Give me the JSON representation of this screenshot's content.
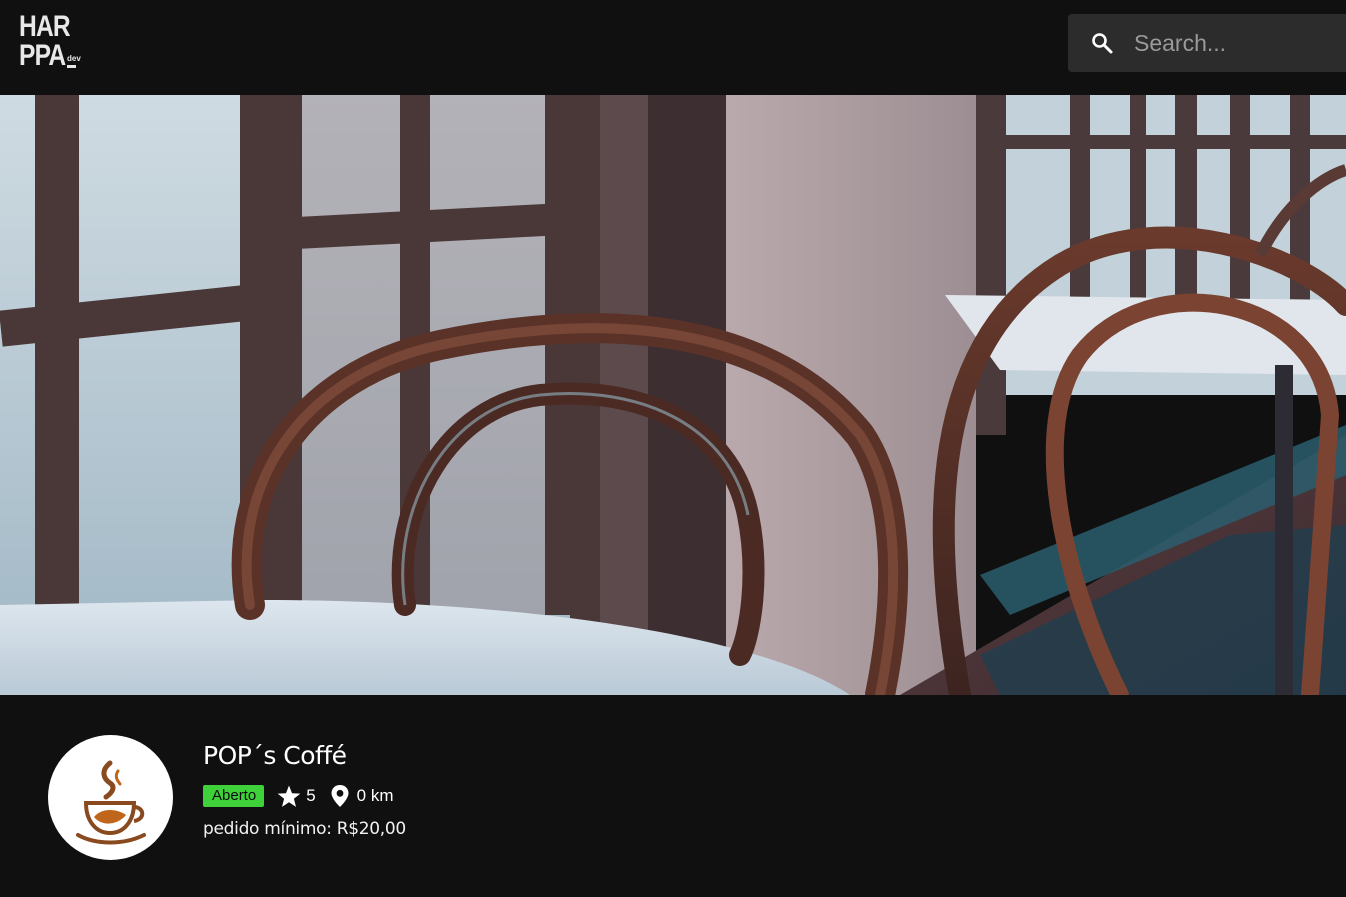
{
  "header": {
    "logo": {
      "line1": "HAR",
      "line2": "PPA",
      "suffix": "dev"
    },
    "search": {
      "placeholder": "Search...",
      "value": "",
      "icon": "search-icon"
    }
  },
  "banner": {
    "image": "cafe-chairs-photo"
  },
  "store": {
    "name": "POP´s Coffé",
    "logo_icon": "coffee-cup-logo",
    "status": "Aberto",
    "rating": "5",
    "rating_icon": "star-icon",
    "distance": "0 km",
    "distance_icon": "location-pin-icon",
    "min_order": "pedido mínimo: R$20,00"
  },
  "colors": {
    "background": "#101010",
    "search_bg": "#2c2c2c",
    "status_badge": "#3fd13a",
    "logo_brown": "#8a4a1f"
  }
}
